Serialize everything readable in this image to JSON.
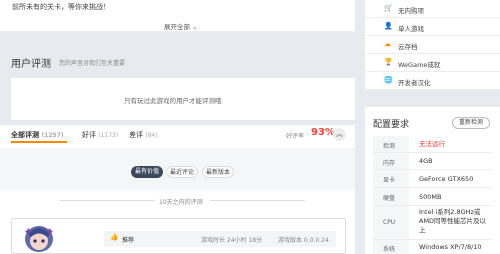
{
  "description": {
    "text": "前所未有的关卡，等你来挑战！",
    "expand_label": "展开全部"
  },
  "reviews": {
    "title": "用户评测",
    "subtitle": "您的声音对我们至关重要",
    "notice": "只有玩过此游戏的用户才能评测哦",
    "tabs": [
      {
        "label": "全部评测",
        "count": "(1257)"
      },
      {
        "label": "好评",
        "count": "(1173)"
      },
      {
        "label": "差评",
        "count": "(84)"
      }
    ],
    "rate_label": "好评率",
    "rate_value": "93%",
    "sort_buttons": [
      "最有价值",
      "最近评论",
      "最新版本"
    ],
    "days_label": "10天之内的评测",
    "item": {
      "recommend": "推荐",
      "playtime": "游戏时长 24小时 18分",
      "version": "游戏版本 0.0.0.24"
    }
  },
  "sidebar": {
    "items": [
      {
        "icon": "cart-icon",
        "label": "无内购项"
      },
      {
        "icon": "user-icon",
        "label": "单人游戏"
      },
      {
        "icon": "cloud-icon",
        "label": "云存档"
      },
      {
        "icon": "trophy-icon",
        "label": "WeGame成就"
      },
      {
        "icon": "globe-icon",
        "label": "开发者汉化"
      }
    ]
  },
  "config": {
    "title": "配置要求",
    "refresh_label": "重新检测",
    "rows": [
      {
        "key": "检测",
        "value": "无法运行",
        "status_color": "#e53935"
      },
      {
        "key": "内存",
        "value": "4GB"
      },
      {
        "key": "显卡",
        "value": "GeForce GTX650"
      },
      {
        "key": "硬盘",
        "value": "500MB"
      },
      {
        "key": "CPU",
        "value": "Intel i系列2.8GHz或AMD同等性能芯片及以上"
      },
      {
        "key": "系统",
        "value": "Windows XP/7/8/10"
      }
    ]
  },
  "colors": {
    "accent": "#ff8a00",
    "rate": "#ff3b30",
    "sort_active_bg": "#3a4a5c"
  }
}
